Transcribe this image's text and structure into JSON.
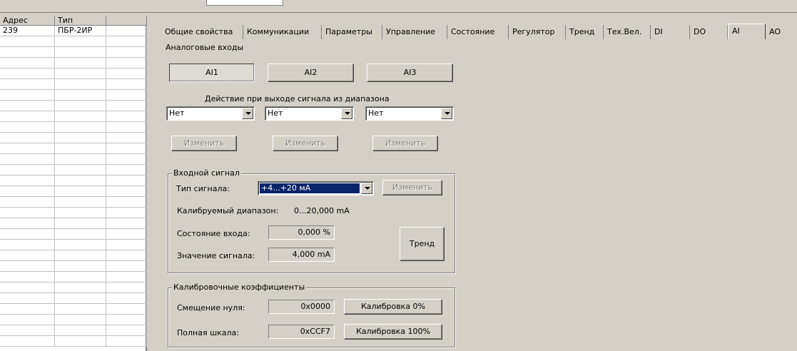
{
  "grid": {
    "headers": [
      "Адрес",
      "Тип",
      ""
    ],
    "rows": [
      {
        "address": "239",
        "type": "ПБР-2ИР",
        "extra": ""
      }
    ]
  },
  "tabs": [
    {
      "label": "Общие свойства"
    },
    {
      "label": "Коммуникации"
    },
    {
      "label": "Параметры"
    },
    {
      "label": "Управление"
    },
    {
      "label": "Состояние"
    },
    {
      "label": "Регулятор"
    },
    {
      "label": "Тренд"
    },
    {
      "label": "Тех.Вел."
    },
    {
      "label": "DI"
    },
    {
      "label": "DO"
    },
    {
      "label": "AI"
    },
    {
      "label": "AO"
    }
  ],
  "active_tab": "AI",
  "section_title": "Аналоговые входы",
  "channels": [
    "AI1",
    "AI2",
    "AI3"
  ],
  "selected_channel": "AI1",
  "out_of_range": {
    "label": "Действие при выходе сигнала из диапазона",
    "values": [
      "Нет",
      "Нет",
      "Нет"
    ],
    "change_label": "Изменить"
  },
  "input_signal": {
    "title": "Входной сигнал",
    "type_label": "Тип сигнала:",
    "type_value": "+4...+20 мА",
    "change_label": "Изменить",
    "calib_range_label": "Калибруемый диапазон:",
    "calib_range_value": "0...20,000 mA",
    "state_label": "Состояние входа:",
    "state_value": "0,000 %",
    "signal_label": "Значение сигнала:",
    "signal_value": "4,000 mA",
    "trend_label": "Тренд"
  },
  "calibration": {
    "title": "Калибровочные коэффициенты",
    "zero_label": "Смещение нуля:",
    "zero_value": "0x0000",
    "zero_button": "Калибровка 0%",
    "full_label": "Полная шкала:",
    "full_value": "0xCCF7",
    "full_button": "Калибровка 100%"
  }
}
